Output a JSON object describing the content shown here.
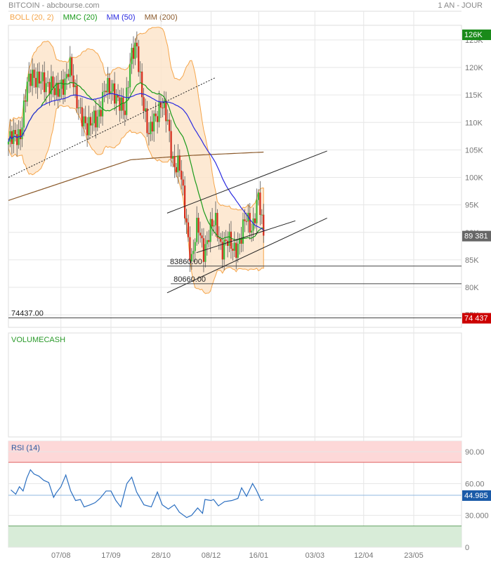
{
  "header": {
    "title": "BITCOIN - abcbourse.com",
    "period": "1 AN - JOUR"
  },
  "legend": [
    {
      "label": "BOLL (20, 2)",
      "color": "#f5a54a"
    },
    {
      "label": "MMC (20)",
      "color": "#1a9a1a"
    },
    {
      "label": "MM (50)",
      "color": "#2a2ae0"
    },
    {
      "label": "MM (200)",
      "color": "#8b5a2b"
    }
  ],
  "colors": {
    "up": "#3cb83c",
    "down": "#d42a1a",
    "boll_fill": "#fde3c8",
    "boll_line": "#f5a54a",
    "mm20": "#1a9a1a",
    "mm50": "#2a2ae0",
    "mm200": "#8b5a2b",
    "rsi": "#2a6ec0"
  },
  "chart_data": [
    {
      "type": "candlestick",
      "title": "BITCOIN",
      "price_unit": "K",
      "ylim": [
        74,
        127
      ],
      "y_ticks": [
        "75K",
        "80K",
        "85K",
        "90K",
        "95K",
        "100K",
        "105K",
        "110K",
        "115K",
        "120K",
        "125K"
      ],
      "y_tick_values": [
        75,
        80,
        85,
        90,
        95,
        100,
        105,
        110,
        115,
        120,
        125
      ],
      "x_ticks": [
        "07/08",
        "17/09",
        "28/10",
        "08/12",
        "16/01",
        "03/03",
        "12/04",
        "23/05"
      ],
      "x_tick_days": [
        43,
        84,
        125,
        166,
        205,
        251,
        291,
        332
      ],
      "day_range": [
        0,
        371
      ],
      "close_anchors_day": [
        0,
        5,
        10,
        15,
        20,
        25,
        30,
        35,
        40,
        45,
        50,
        55,
        60,
        65,
        70,
        75,
        80,
        85,
        90,
        95,
        100,
        105,
        110,
        115,
        120,
        125,
        130,
        135,
        140,
        145,
        150,
        155,
        160,
        165,
        170,
        175,
        180,
        185,
        190,
        195,
        200,
        205,
        209
      ],
      "close_anchors_value": [
        106.5,
        107,
        108.5,
        116,
        119,
        118,
        116,
        118,
        114.5,
        117,
        121,
        114,
        112,
        108,
        111,
        112,
        116,
        117,
        113,
        112,
        122,
        123,
        115,
        107,
        111,
        114,
        110,
        103,
        102,
        93,
        85,
        91,
        87,
        90,
        92,
        87,
        88,
        87.5,
        88,
        93,
        91,
        96,
        89.4
      ],
      "mm200_anchors_day": [
        0,
        50,
        100,
        150,
        209
      ],
      "mm200_anchors_value": [
        95.8,
        99.5,
        103.2,
        104,
        104.6
      ],
      "badges": [
        {
          "label": "126K",
          "value": 126,
          "color": "#1a8a1a"
        },
        {
          "label": "89 381",
          "value": 89.381,
          "color": "#666666"
        },
        {
          "label": "74 437",
          "value": 74.437,
          "color": "#cc0000"
        }
      ],
      "levels": [
        {
          "label": "83860.00",
          "value": 83.86,
          "from_day": 130
        },
        {
          "label": "80660.00",
          "value": 80.66,
          "from_day": 133
        },
        {
          "label": "74437.00",
          "value": 74.437,
          "from_day": 0
        }
      ],
      "trendlines": [
        {
          "style": "dotted",
          "from": [
            0,
            100
          ],
          "to": [
            170,
            118.2
          ]
        },
        {
          "style": "solid",
          "from": [
            130,
            93.5
          ],
          "to": [
            261,
            104.8
          ]
        },
        {
          "style": "solid",
          "from": [
            154,
            86.3
          ],
          "to": [
            235,
            92.1
          ]
        },
        {
          "style": "solid",
          "from": [
            130,
            79.0
          ],
          "to": [
            261,
            92.6
          ]
        }
      ]
    },
    {
      "type": "bar",
      "title": "VOLUMECASH",
      "values": []
    },
    {
      "type": "line",
      "title": "RSI (14)",
      "ylim": [
        0,
        100
      ],
      "y_ticks": [
        "0",
        "30.000",
        "60.00",
        "90.00"
      ],
      "y_tick_values": [
        0,
        30,
        60,
        90
      ],
      "overbought": 80,
      "oversold": 20,
      "last_value": "44.985",
      "last_value_level": 49,
      "x_day": [
        2,
        6,
        9,
        12,
        15,
        18,
        21,
        25,
        29,
        33,
        37,
        39,
        43,
        47,
        51,
        55,
        59,
        62,
        67,
        71,
        75,
        80,
        84,
        88,
        92,
        97,
        101,
        105,
        111,
        117,
        122,
        126,
        131,
        136,
        140,
        146,
        150,
        155,
        159,
        161,
        166,
        168,
        172,
        177,
        183,
        188,
        191,
        195,
        200,
        203,
        207,
        209
      ],
      "values": [
        54,
        50,
        57,
        53,
        65,
        73,
        69,
        67,
        63,
        61,
        47,
        51,
        57,
        68,
        53,
        44,
        45,
        38,
        40,
        42,
        46,
        53,
        53,
        44,
        38,
        60,
        66,
        52,
        40,
        38,
        52,
        40,
        36,
        40,
        33,
        28,
        30,
        37,
        32,
        45,
        44,
        45,
        39,
        43,
        44,
        46,
        56,
        48,
        60,
        54,
        44,
        45
      ]
    }
  ]
}
